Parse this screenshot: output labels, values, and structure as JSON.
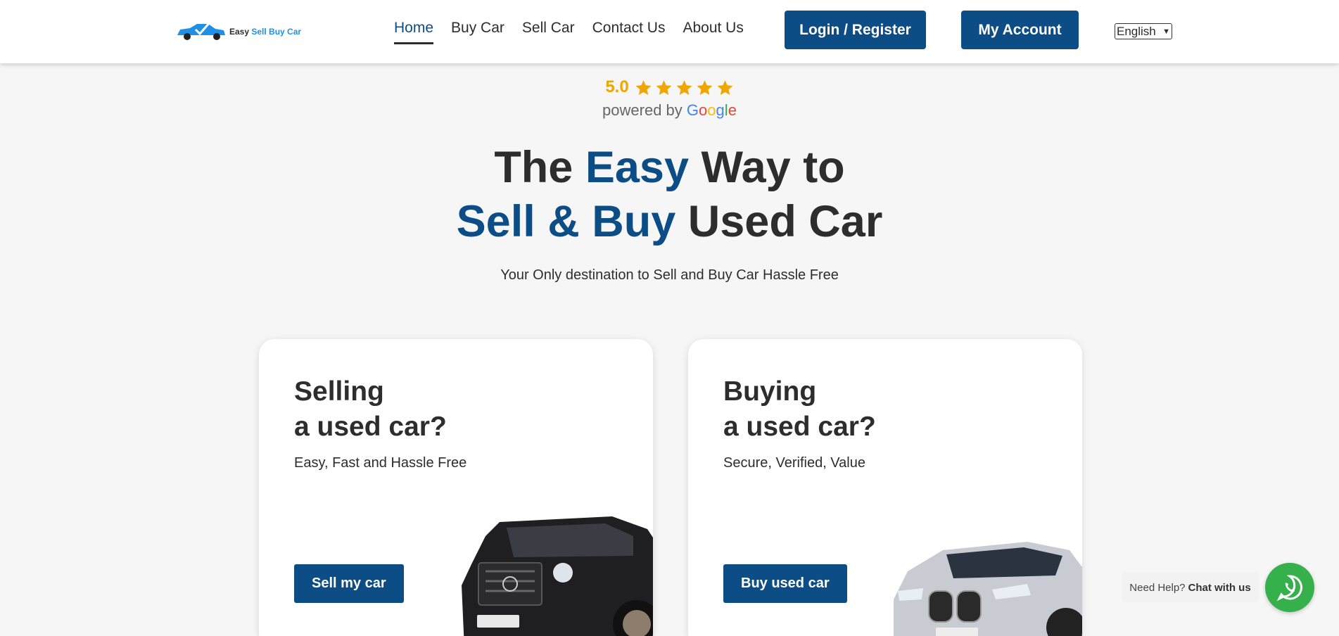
{
  "header": {
    "logo": {
      "easy": "Easy",
      "sell_buy": "Sell Buy Car"
    },
    "nav": [
      {
        "label": "Home",
        "active": true
      },
      {
        "label": "Buy Car",
        "active": false
      },
      {
        "label": "Sell Car",
        "active": false
      },
      {
        "label": "Contact Us",
        "active": false
      },
      {
        "label": "About Us",
        "active": false
      }
    ],
    "login_label": "Login / Register",
    "account_label": "My Account",
    "language": "English"
  },
  "rating": {
    "value": "5.0",
    "stars": 5,
    "powered_by": "powered by",
    "google_letters": [
      "G",
      "o",
      "o",
      "g",
      "l",
      "e"
    ]
  },
  "hero": {
    "line1_part1": "The",
    "line1_highlight": "Easy",
    "line1_part2": "Way to",
    "line2_highlight": "Sell & Buy",
    "line2_part2": "Used Car",
    "subtitle": "Your Only destination to Sell and Buy Car Hassle Free"
  },
  "cards": {
    "sell": {
      "title_line1": "Selling",
      "title_line2": "a used car?",
      "subtitle": "Easy, Fast and Hassle Free",
      "button": "Sell my car"
    },
    "buy": {
      "title_line1": "Buying",
      "title_line2": "a used car?",
      "subtitle": "Secure, Verified, Value",
      "button": "Buy used car"
    }
  },
  "chat": {
    "prefix": "Need Help?",
    "strong": "Chat with us"
  },
  "colors": {
    "brand": "#0d4d86",
    "accent_blue": "#1e90e6",
    "star": "#f0a500",
    "whatsapp": "#35b04a"
  },
  "icons": [
    "car-logo-icon",
    "star-icon",
    "chevron-down-icon",
    "whatsapp-icon"
  ]
}
